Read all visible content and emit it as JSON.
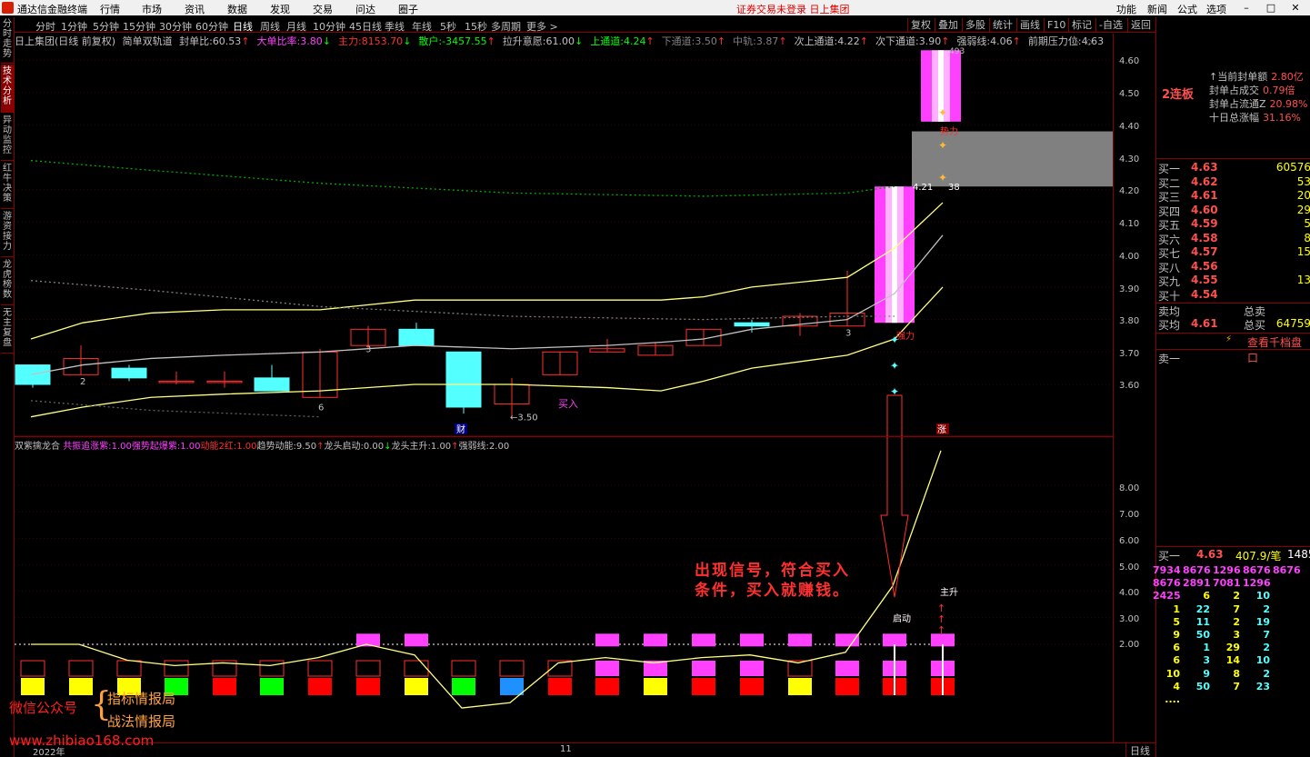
{
  "app": {
    "name": "通达信金融终端",
    "menus": [
      "行情",
      "市场",
      "资讯",
      "数据",
      "发现",
      "交易",
      "问达",
      "圈子"
    ],
    "center_text": "证券交易未登录  日上集团",
    "right_menus": [
      "功能",
      "新闻",
      "公式",
      "选项"
    ]
  },
  "period_bar": {
    "periods": [
      "分时",
      "1分钟",
      "5分钟",
      "15分钟",
      "30分钟",
      "60分钟",
      "日线",
      "周线",
      "月线",
      "10分钟",
      "45日线",
      "季线",
      "年线",
      "5秒",
      "15秒",
      "多周期",
      "更多 >"
    ],
    "active": "日线",
    "right_buttons": [
      "复权",
      "叠加",
      "多股",
      "统计",
      "画线",
      "F10",
      "标记",
      "-自选",
      "返回"
    ]
  },
  "left_tabs": [
    "分时走势",
    "技术分析",
    "异动监控",
    "红牛决策",
    "游资接力",
    "龙虎榜数",
    "无主复盘"
  ],
  "left_active": "技术分析",
  "main_info": {
    "stock": "日上集团(日线 前复权)",
    "indicator_name": "简单双轨道",
    "items": [
      {
        "label": "封单比:",
        "value": "60.53",
        "arrow": "↑",
        "color": "#c0c0c0"
      },
      {
        "label": "大单比率:",
        "value": "3.80",
        "arrow": "↓",
        "color": "#ff40ff"
      },
      {
        "label": "主力:",
        "value": "8153.70",
        "arrow": "↓",
        "color": "#ff3030"
      },
      {
        "label": "散户:",
        "value": "-3457.55",
        "arrow": "↑",
        "color": "#00ff00"
      },
      {
        "label": "拉升意愿:",
        "value": "61.00",
        "arrow": "↓",
        "color": "#c0c0c0"
      },
      {
        "label": "上通道:",
        "value": "4.24",
        "arrow": "↑",
        "color": "#00ff00"
      },
      {
        "label": "下通道:",
        "value": "3.50",
        "arrow": "↑",
        "color": "#808080"
      },
      {
        "label": "中轨:",
        "value": "3.87",
        "arrow": "↑",
        "color": "#808080"
      },
      {
        "label": "次上通道:",
        "value": "4.22",
        "arrow": "↑",
        "color": "#c0c0c0"
      },
      {
        "label": "次下通道:",
        "value": "3.90",
        "arrow": "↑",
        "color": "#c0c0c0"
      },
      {
        "label": "强弱线:",
        "value": "4.06",
        "arrow": "↑",
        "color": "#c0c0c0"
      },
      {
        "label": "前期压力位:",
        "value": "4.63",
        "arrow": "",
        "color": "#c0c0c0"
      }
    ]
  },
  "indicator_info": {
    "name": "双紫擒龙合",
    "items": [
      {
        "label": "共振追涨紫:",
        "value": "1.00",
        "arrow": "",
        "color": "#ff40ff"
      },
      {
        "label": "强势起爆紫:",
        "value": "1.00",
        "arrow": "",
        "color": "#ff40ff"
      },
      {
        "label": "动能2红:",
        "value": "1.00",
        "arrow": "",
        "color": "#ff3030"
      },
      {
        "label": "趋势动能:",
        "value": "9.50",
        "arrow": "↑",
        "color": "#c0c0c0"
      },
      {
        "label": "龙头启动:",
        "value": "0.00",
        "arrow": "↓",
        "color": "#c0c0c0"
      },
      {
        "label": "龙头主升:",
        "value": "1.00",
        "arrow": "↑",
        "color": "#c0c0c0"
      },
      {
        "label": "强弱线:",
        "value": "2.00",
        "arrow": "",
        "color": "#c0c0c0"
      }
    ]
  },
  "price_axis": [
    "4.60",
    "4.50",
    "4.40",
    "4.30",
    "4.20",
    "4.10",
    "4.00",
    "3.90",
    "3.80",
    "3.70",
    "3.60"
  ],
  "ind_axis": [
    "8.00",
    "7.00",
    "6.00",
    "5.00",
    "4.00",
    "3.00",
    "2.00"
  ],
  "chart_labels": {
    "low_marker": "←3.50",
    "buy_label": "买入",
    "cai_label": "财",
    "zhang_label": "涨",
    "label_2": "2",
    "label_6": "6",
    "label_3a": "3",
    "label_3b": "3",
    "label_force1": "势力",
    "label_force2": "强力",
    "price_421": "4.21",
    "price_438": "38",
    "top_label": "493",
    "start_label": "启动",
    "main_rise_label": "主升"
  },
  "annotation": [
    "出现信号，符合买入",
    "条件，买入就赚钱。"
  ],
  "date_line": {
    "left": "2022年",
    "mid": "11",
    "right": "日线"
  },
  "right_panel": {
    "boards": "2连板",
    "seal_info": [
      {
        "label": "↑当前封单额",
        "value": "2.80亿"
      },
      {
        "label": "封单占成交",
        "value": "0.79倍"
      },
      {
        "label": "封单占流通Z",
        "value": "20.98%"
      },
      {
        "label": "十日总涨幅",
        "value": "31.16%"
      }
    ],
    "bids": [
      {
        "label": "买一",
        "price": "4.63",
        "vol": "60576"
      },
      {
        "label": "买二",
        "price": "4.62",
        "vol": "53"
      },
      {
        "label": "买三",
        "price": "4.61",
        "vol": "20"
      },
      {
        "label": "买四",
        "price": "4.60",
        "vol": "29"
      },
      {
        "label": "买五",
        "price": "4.59",
        "vol": "5"
      },
      {
        "label": "买六",
        "price": "4.58",
        "vol": "8"
      },
      {
        "label": "买七",
        "price": "4.57",
        "vol": "15"
      },
      {
        "label": "买八",
        "price": "4.56",
        "vol": ""
      },
      {
        "label": "买九",
        "price": "4.55",
        "vol": "13"
      },
      {
        "label": "买十",
        "price": "4.54",
        "vol": ""
      }
    ],
    "avg_sell": {
      "label": "卖均",
      "price": "",
      "label2": "总卖",
      "vol": ""
    },
    "avg_buy": {
      "label": "买均",
      "price": "4.61",
      "label2": "总买",
      "vol": "64759"
    },
    "view_button": "查看千档盘口",
    "sell_one": "卖一",
    "bottom_buy": {
      "label": "买一",
      "price": "4.63",
      "per": "407.9/笔",
      "vol": "1485"
    },
    "queue_rows": [
      [
        "7934",
        "8676",
        "1296",
        "8676",
        "8676"
      ],
      [
        "8676",
        "2891",
        "7081",
        "1296",
        ""
      ],
      [
        "2425",
        "6",
        "2",
        "10",
        ""
      ],
      [
        "1",
        "22",
        "7",
        "2",
        ""
      ],
      [
        "5",
        "11",
        "2",
        "19",
        ""
      ],
      [
        "9",
        "50",
        "3",
        "7",
        ""
      ],
      [
        "6",
        "1",
        "29",
        "2",
        ""
      ],
      [
        "6",
        "3",
        "14",
        "10",
        ""
      ],
      [
        "10",
        "9",
        "8",
        "2",
        ""
      ],
      [
        "4",
        "50",
        "7",
        "23",
        ""
      ],
      [
        "....",
        "",
        "",
        "",
        ""
      ]
    ]
  },
  "watermark": {
    "wechat": "微信公众号",
    "line1": "指标情报局",
    "line2": "战法情报局",
    "site": "www.zhibiao168.com"
  },
  "colors": {
    "up": "#ff3030",
    "down": "#54ffff",
    "ma": "#ffff80",
    "magenta": "#ff40ff",
    "frame": "#800000"
  }
}
